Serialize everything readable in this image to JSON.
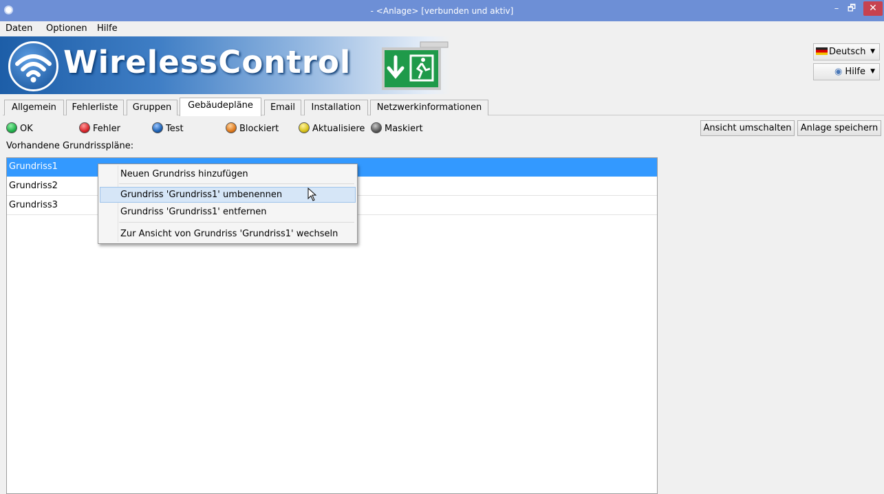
{
  "window": {
    "title": "- <Anlage> [verbunden und aktiv]",
    "minimize": "–",
    "restore": "🗗",
    "close": "✕"
  },
  "menu": {
    "items": [
      "Daten",
      "Optionen",
      "Hilfe"
    ]
  },
  "banner": {
    "brand": "WirelessControl",
    "language_button": "Deutsch",
    "help_button": "Hilfe"
  },
  "tabs": [
    {
      "label": "Allgemein",
      "active": false
    },
    {
      "label": "Fehlerliste",
      "active": false
    },
    {
      "label": "Gruppen",
      "active": false
    },
    {
      "label": "Gebäudepläne",
      "active": true
    },
    {
      "label": "Email",
      "active": false
    },
    {
      "label": "Installation",
      "active": false
    },
    {
      "label": "Netzwerkinformationen",
      "active": false
    }
  ],
  "legend": [
    {
      "label": "OK",
      "color": "#22b14c"
    },
    {
      "label": "Fehler",
      "color": "#d9262c"
    },
    {
      "label": "Test",
      "color": "#1e63b5"
    },
    {
      "label": "Blockiert",
      "color": "#e07b1f"
    },
    {
      "label": "Aktualisiere",
      "color": "#d8c21a"
    },
    {
      "label": "Maskiert",
      "color": "#5b5b5b"
    }
  ],
  "actions": {
    "toggle_view": "Ansicht umschalten",
    "save_plant": "Anlage speichern"
  },
  "plans": {
    "label": "Vorhandene Grundrisspläne:",
    "items": [
      {
        "name": "Grundriss1",
        "selected": true
      },
      {
        "name": "Grundriss2",
        "selected": false
      },
      {
        "name": "Grundriss3",
        "selected": false
      }
    ]
  },
  "context_menu": {
    "items": [
      "Neuen Grundriss hinzufügen",
      "Grundriss 'Grundriss1' umbenennen",
      "Grundriss 'Grundriss1' entfernen",
      "Zur Ansicht von Grundriss 'Grundriss1' wechseln"
    ],
    "hovered_index": 1
  }
}
